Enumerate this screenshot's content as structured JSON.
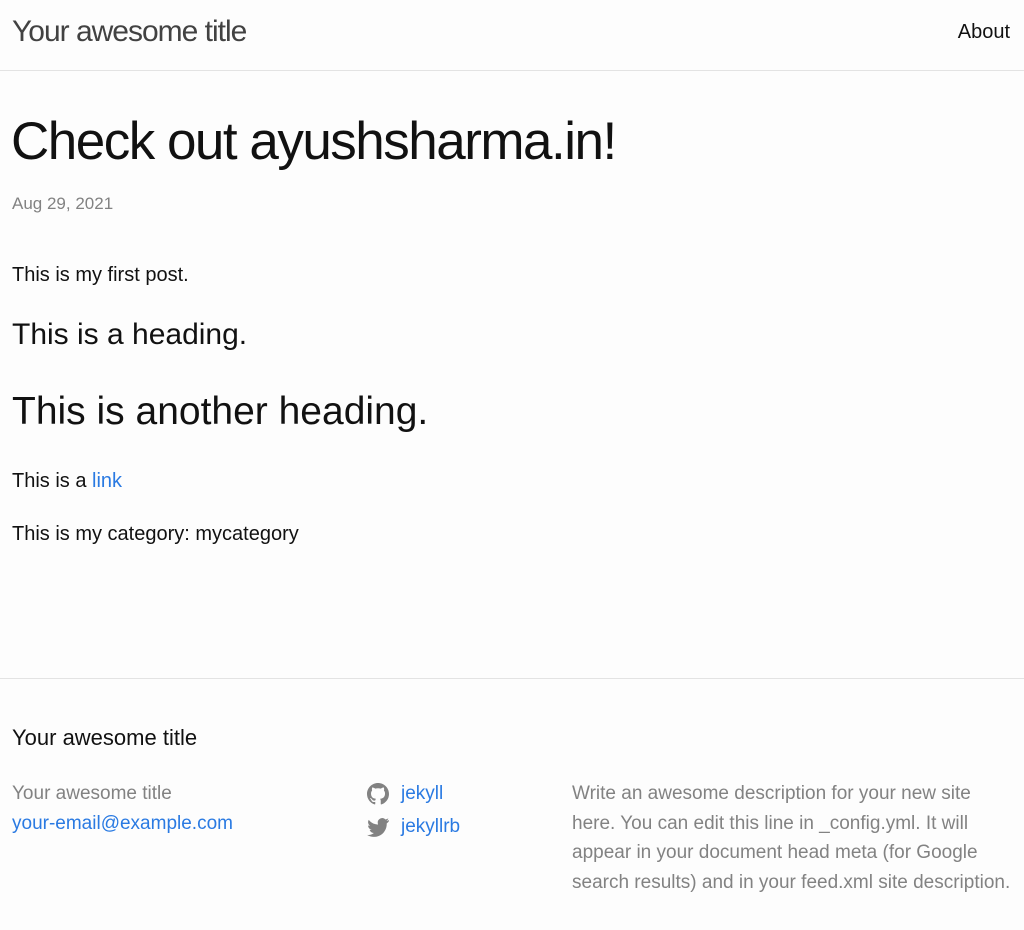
{
  "header": {
    "site_title": "Your awesome title",
    "nav": {
      "about": "About"
    }
  },
  "post": {
    "title": "Check out ayushsharma.in!",
    "date": "Aug 29, 2021",
    "paragraph1": "This is my first post.",
    "heading2": "This is a heading.",
    "heading1": "This is another heading.",
    "paragraph2_prefix": "This is a ",
    "paragraph2_link": "link",
    "paragraph3": "This is my category: mycategory"
  },
  "footer": {
    "heading": "Your awesome title",
    "contact": {
      "name": "Your awesome title",
      "email": "your-email@example.com"
    },
    "social": [
      {
        "icon": "github-icon",
        "label": "jekyll"
      },
      {
        "icon": "twitter-icon",
        "label": "jekyllrb"
      }
    ],
    "description": "Write an awesome description for your new site here. You can edit this line in _config.yml. It will appear in your document head meta (for Google search results) and in your feed.xml site description."
  },
  "colors": {
    "link": "#2a7ae2",
    "muted": "#828282",
    "border": "#e3e3e3",
    "background": "#fdfdfd"
  }
}
